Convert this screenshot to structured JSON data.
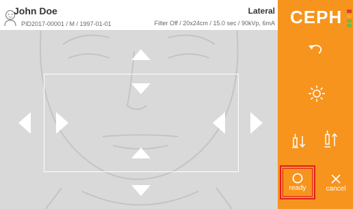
{
  "header": {
    "patient_name": "John Doe",
    "patient_meta": "PID2017-00001 / M / 1997-01-01",
    "view_mode": "Lateral",
    "exposure": "Filter Off / 20x24cm / 15.0 sec / 90kVp, 6mA"
  },
  "sidebar": {
    "brand": "CEPH",
    "ready_label": "ready",
    "cancel_label": "cancel",
    "level_meter_colors": [
      "#e53935",
      "#f9a825",
      "#7cb342",
      "#7cb342"
    ]
  },
  "colors": {
    "accent": "#f7941d",
    "viewport_bg": "#d9d9d9",
    "highlight": "#e12020"
  }
}
